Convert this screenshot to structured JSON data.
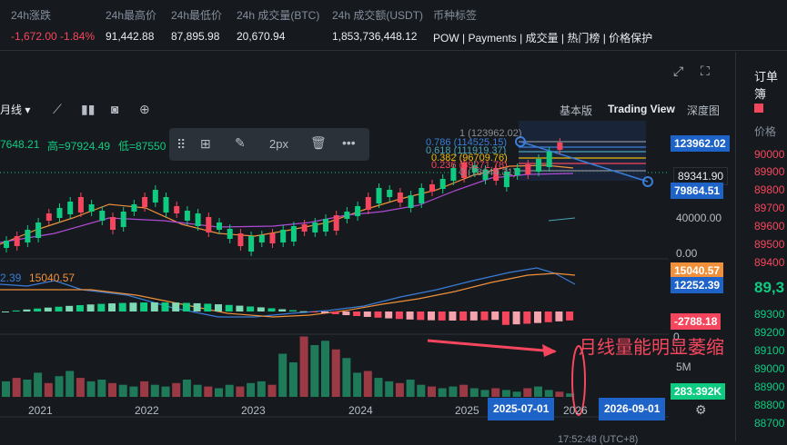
{
  "ticker": {
    "change_label": "24h涨跌",
    "change_value": "-1,672.00 -1.84%",
    "high_label": "24h最高价",
    "high_value": "91,442.88",
    "low_label": "24h最低价",
    "low_value": "87,895.98",
    "vol_btc_label": "24h 成交量(BTC)",
    "vol_btc_value": "20,670.94",
    "vol_usdt_label": "24h 成交额(USDT)",
    "vol_usdt_value": "1,853,736,448.12",
    "tags_label": "币种标签",
    "tags_value": "POW | Payments | 成交量 | 热门榜 | 价格保护"
  },
  "toolbar": {
    "interval": "月线",
    "view_basic": "基本版",
    "view_tradingview": "Trading View",
    "view_depth": "深度图"
  },
  "ohlc": {
    "close": "7648.21",
    "high_text": "高=97924.49",
    "low_text": "低=87550"
  },
  "drawbar": {
    "stroke_width": "2px"
  },
  "fib_labels": [
    "1 (123962.02)",
    "0.786 (114525.15)",
    "0.618 (111919.37)",
    "0.382 (96709.76)",
    "0.236 (89271.78)",
    "0 (78644.31)"
  ],
  "price_axis": {
    "tag_high": "123962.02",
    "tag_current": "89341.90",
    "tag_low": "79864.51",
    "tick_40000": "40000.00",
    "tick_0": "0.00"
  },
  "macd": {
    "label_left": "2.39",
    "label_value": "15040.57",
    "tag_1": "15040.57",
    "tag_2": "12252.39",
    "tag_3": "-2788.18",
    "tick_0": "0"
  },
  "volume": {
    "tick_5m": "5M",
    "tag_vol": "283.392K"
  },
  "annotation": "月线量能明显萎缩",
  "x_axis": {
    "labels": [
      "2021",
      "2022",
      "2023",
      "2024",
      "2025",
      "2026"
    ],
    "date_left": "2025-07-01",
    "date_right": "2026-09-01"
  },
  "status": {
    "time": "17:52:48 (UTC+8)"
  },
  "right_panel": {
    "title": "订单簿",
    "price_label": "价格",
    "prices": [
      "90000",
      "89900",
      "89800",
      "89700",
      "89600",
      "89500",
      "89400"
    ],
    "last_price": "89,3",
    "bids": [
      "89300",
      "89200",
      "89100",
      "89000",
      "88900",
      "88800",
      "88700"
    ]
  },
  "colors": {
    "up": "#0ecb81",
    "down": "#f6465d",
    "accent": "#f0b90b",
    "bg": "#161a1e"
  }
}
